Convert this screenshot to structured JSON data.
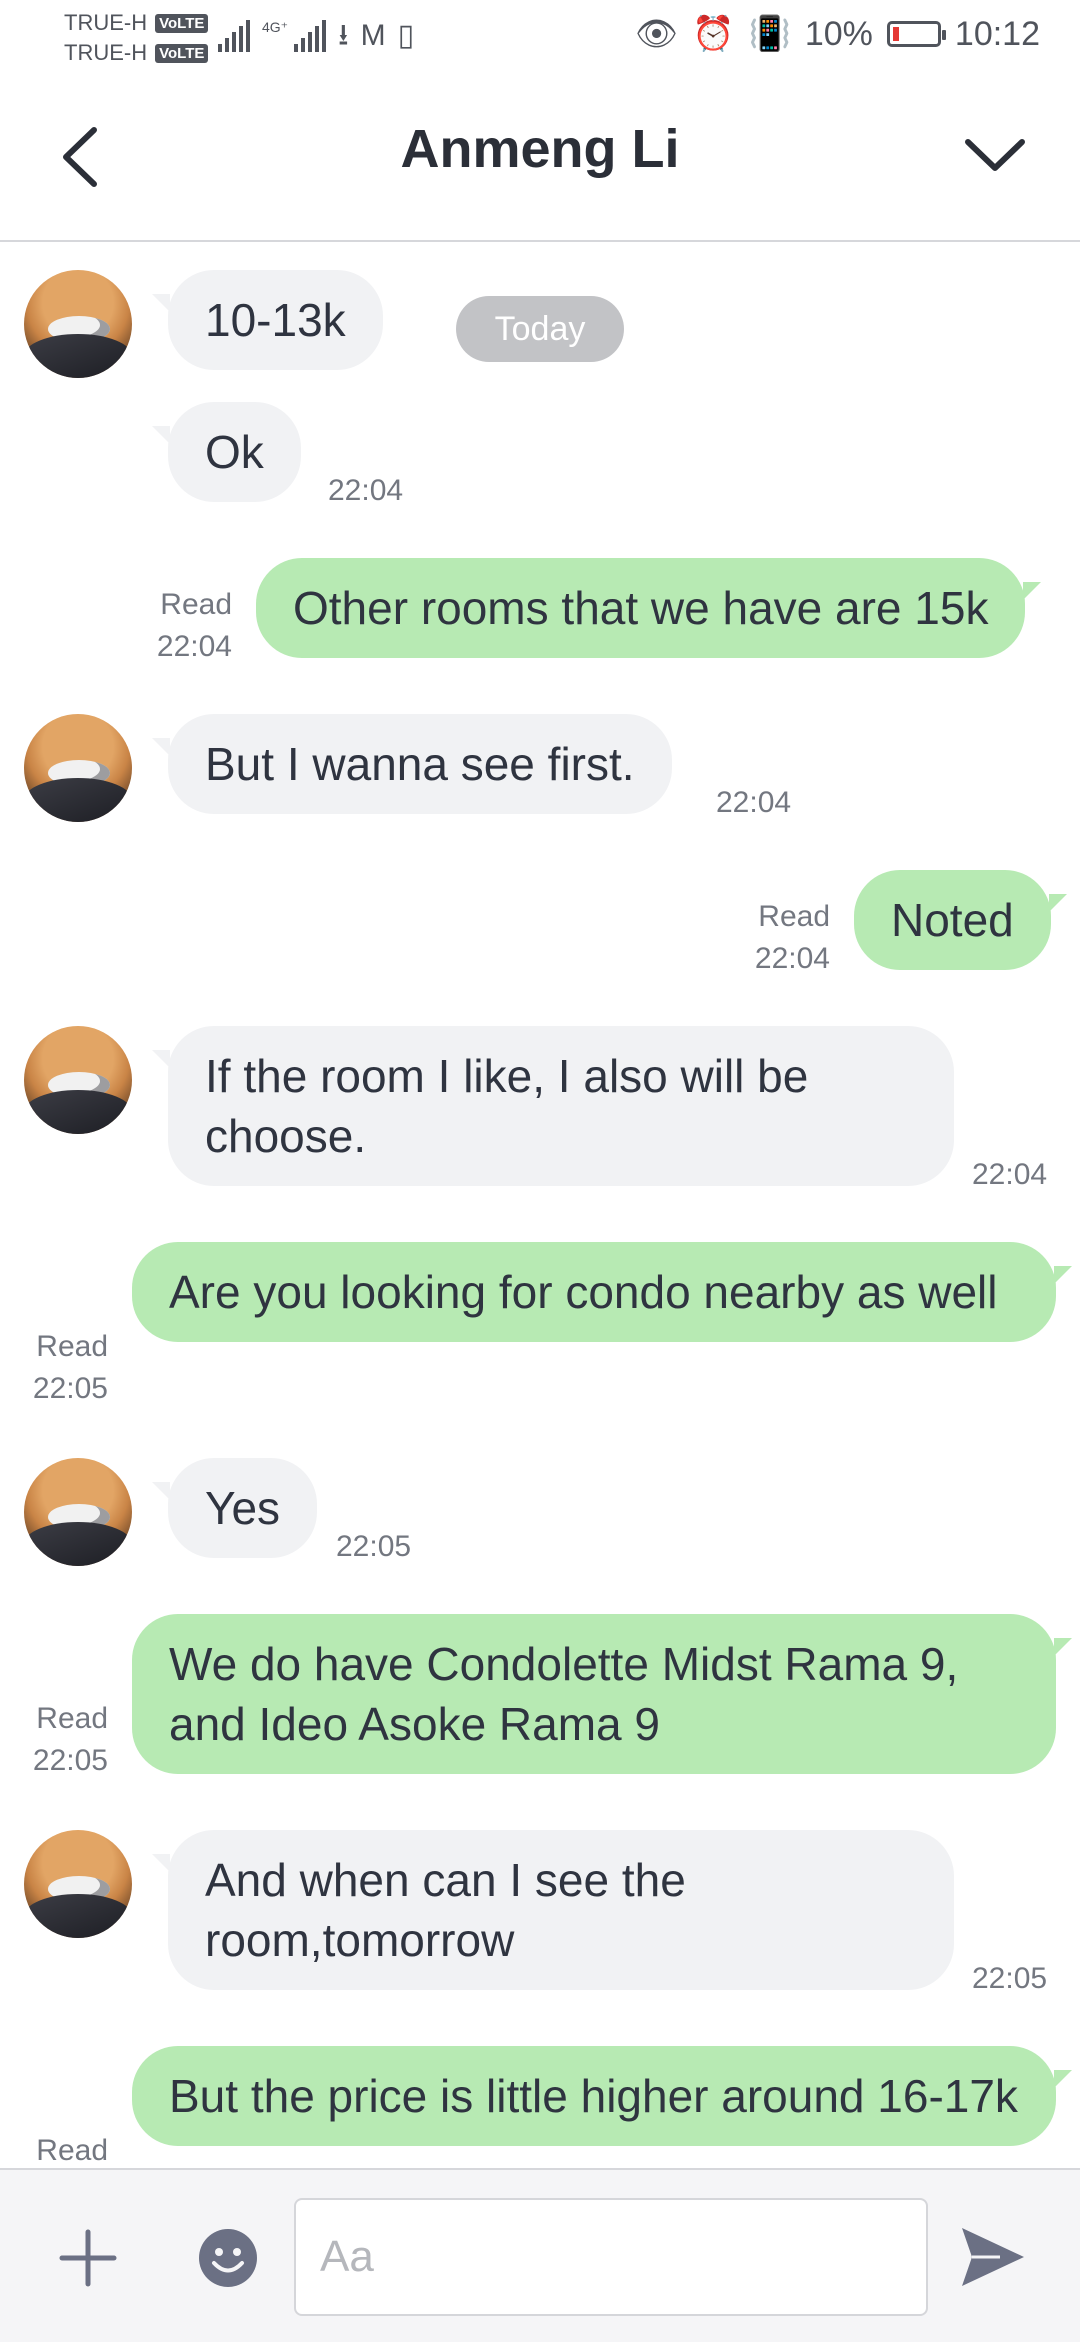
{
  "status_bar": {
    "carrier1": "TRUE-H",
    "carrier2": "TRUE-H",
    "volte": "VoLTE",
    "network": "4G⁺",
    "battery": "10%",
    "time": "10:12"
  },
  "header": {
    "title": "Anmeng Li"
  },
  "chat": {
    "date_divider": "Today",
    "messages": [
      {
        "side": "in",
        "text": "10-13k"
      },
      {
        "side": "in",
        "text": "Ok",
        "time": "22:04"
      },
      {
        "side": "out",
        "text": "Other rooms that we have are 15k",
        "read": "Read",
        "time": "22:04"
      },
      {
        "side": "in",
        "text": "But I wanna see first.",
        "time": "22:04"
      },
      {
        "side": "out",
        "text": "Noted",
        "read": "Read",
        "time": "22:04"
      },
      {
        "side": "in",
        "text": "If the room I like, I also will be choose.",
        "time": "22:04"
      },
      {
        "side": "out",
        "text": "Are you looking for condo nearby as well",
        "read": "Read",
        "time": "22:05"
      },
      {
        "side": "in",
        "text": "Yes",
        "time": "22:05"
      },
      {
        "side": "out",
        "text": "We do have Condolette Midst Rama 9, and Ideo Asoke Rama 9",
        "read": "Read",
        "time": "22:05"
      },
      {
        "side": "in",
        "text": "And when can I see the room,tomorrow",
        "time": "22:05"
      },
      {
        "side": "out",
        "text": "But the price is little higher around 16-17k",
        "read": "Read"
      }
    ]
  },
  "input": {
    "placeholder": "Aa"
  },
  "icons": {
    "back": "chevron-left-icon",
    "menu": "chevron-down-icon",
    "plus": "plus-icon",
    "emoji": "emoji-icon",
    "send": "send-icon"
  }
}
